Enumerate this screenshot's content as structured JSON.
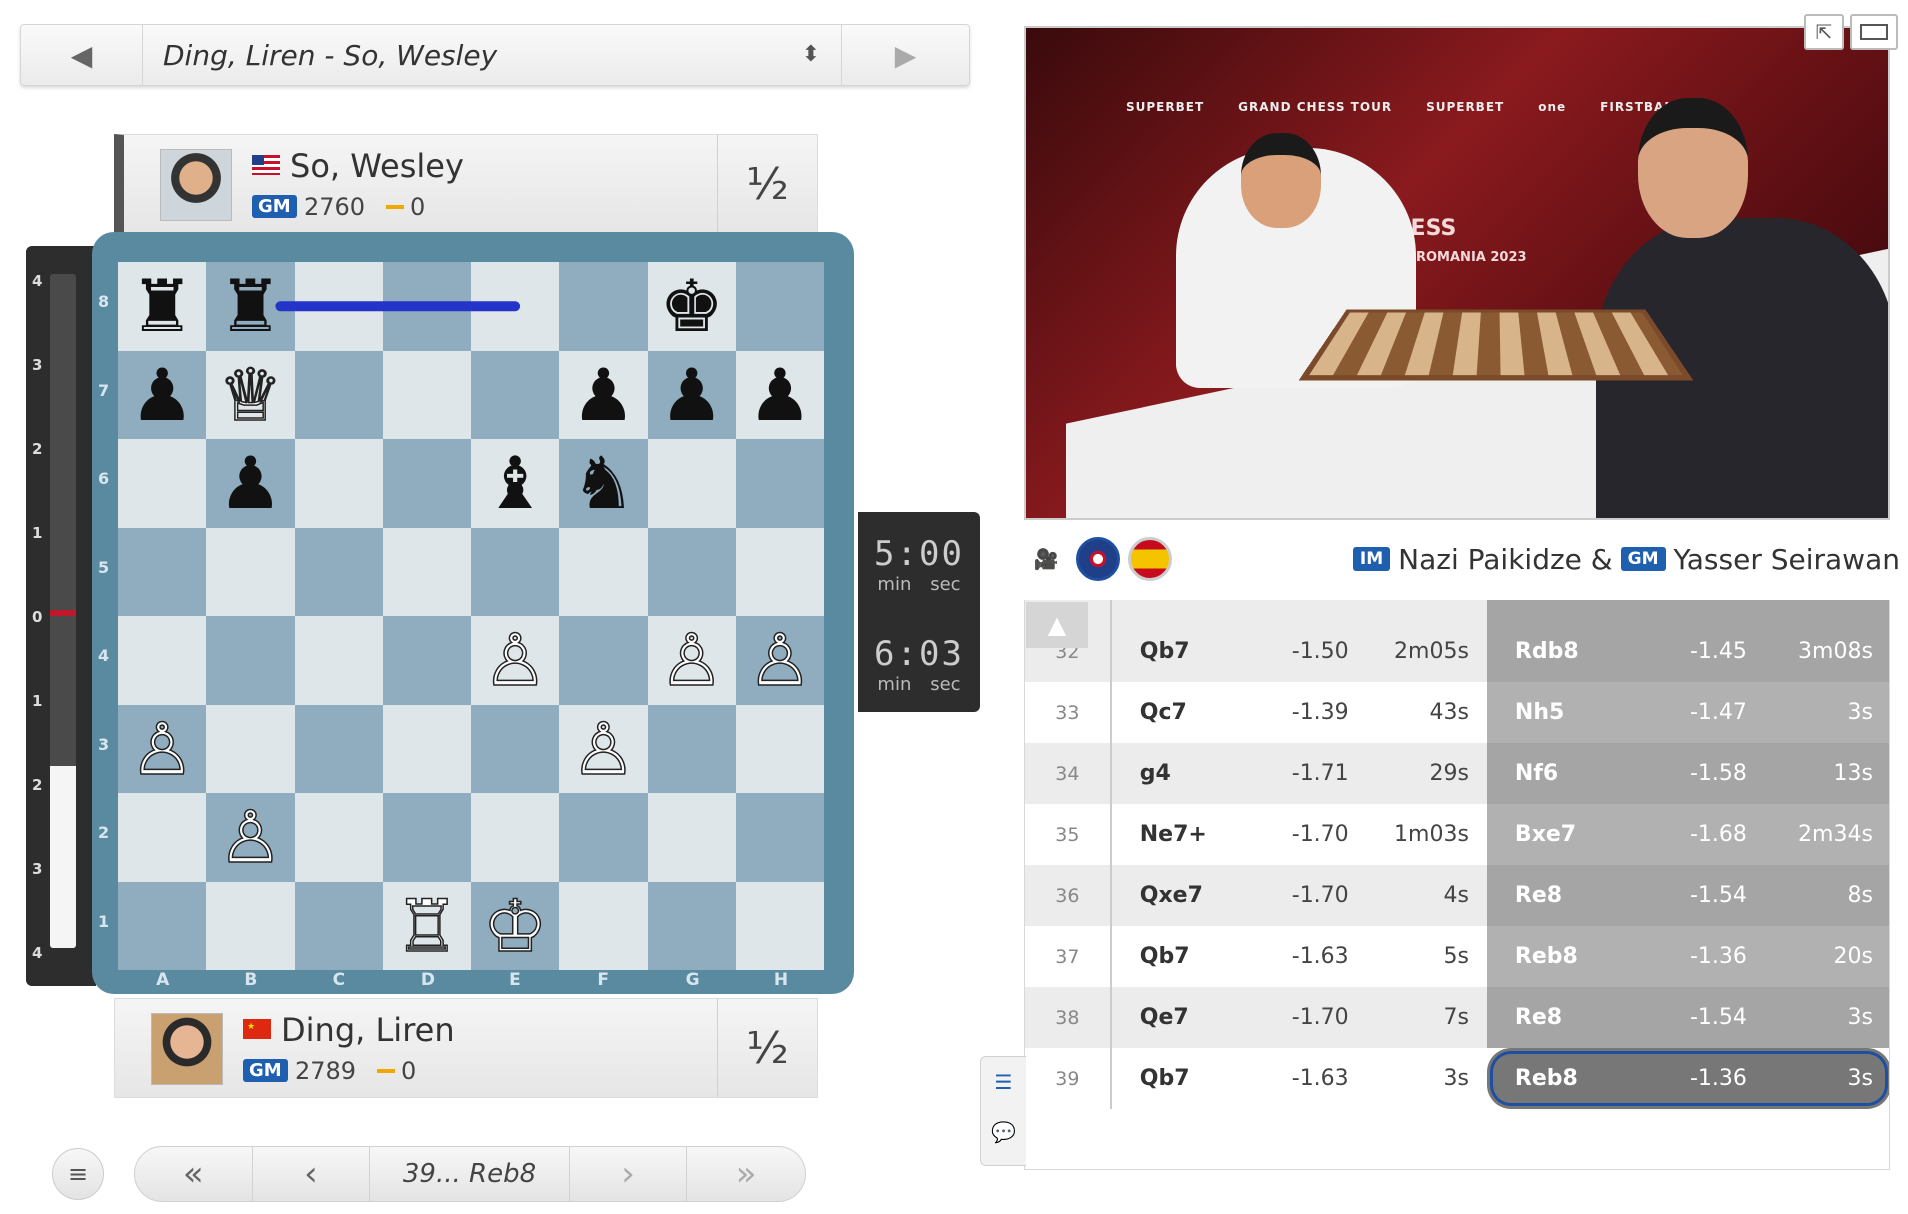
{
  "game_selector": {
    "title": "Ding, Liren - So, Wesley",
    "prev_icon": "◀",
    "next_icon": "▶",
    "updown_icon": "⬍"
  },
  "top_player": {
    "name": "So, Wesley",
    "flag": "us-flag",
    "title": "GM",
    "rating": "2760",
    "score": "0",
    "result": "½"
  },
  "bottom_player": {
    "name": "Ding, Liren",
    "flag": "cn-flag",
    "title": "GM",
    "rating": "2789",
    "score": "0",
    "result": "½"
  },
  "eval_bar": {
    "ticks": [
      "4",
      "3",
      "2",
      "1",
      "0",
      "1",
      "2",
      "3",
      "4"
    ],
    "white_share": 0.27
  },
  "board": {
    "ranks": [
      "8",
      "7",
      "6",
      "5",
      "4",
      "3",
      "2",
      "1"
    ],
    "files": [
      "A",
      "B",
      "C",
      "D",
      "E",
      "F",
      "G",
      "H"
    ],
    "position": [
      [
        "♜",
        "♜",
        "",
        "",
        "",
        "",
        "♚",
        ""
      ],
      [
        "♟",
        "♕",
        "",
        "",
        "",
        "♟",
        "♟",
        "♟"
      ],
      [
        "",
        "♟",
        "",
        "",
        "♝",
        "♞",
        "",
        ""
      ],
      [
        "",
        "",
        "",
        "",
        "",
        "",
        "",
        ""
      ],
      [
        "",
        "",
        "",
        "",
        "♙",
        "",
        "♙",
        "♙"
      ],
      [
        "♙",
        "",
        "",
        "",
        "",
        "♙",
        "",
        ""
      ],
      [
        "",
        "♙",
        "",
        "",
        "",
        "",
        "",
        ""
      ],
      [
        "",
        "",
        "",
        "♖",
        "♔",
        "",
        "",
        ""
      ]
    ],
    "last_move": {
      "from": "e8",
      "to": "b8"
    },
    "arrow_color": "#2433c8"
  },
  "clocks": {
    "top": {
      "time": "5:00",
      "min_label": "min",
      "sec_label": "sec"
    },
    "bottom": {
      "time": "6:03",
      "min_label": "min",
      "sec_label": "sec"
    }
  },
  "move_nav": {
    "first_icon": "«",
    "prev_icon": "‹",
    "current_move": "39... Reb8",
    "next_icon": "›",
    "last_icon": "»",
    "menu_icon": "≡"
  },
  "video": {
    "sponsors": [
      "SUPERBET",
      "GRAND CHESS TOUR",
      "SUPERBET",
      "one",
      "FIRSTBANK"
    ],
    "event_title": "CHESS",
    "event_subtitle": "ROMANIA 2023"
  },
  "commentary": {
    "commentator1_title": "IM",
    "commentator1_name": "Nazi Paikidze &",
    "commentator2_title": "GM",
    "commentator2_name": "Yasser Seirawan"
  },
  "moves": [
    {
      "num": "32",
      "white": "Qb7",
      "white_eval": "-1.50",
      "white_time": "2m05s",
      "black": "Rdb8",
      "black_eval": "-1.45",
      "black_time": "3m08s"
    },
    {
      "num": "33",
      "white": "Qc7",
      "white_eval": "-1.39",
      "white_time": "43s",
      "black": "Nh5",
      "black_eval": "-1.47",
      "black_time": "3s"
    },
    {
      "num": "34",
      "white": "g4",
      "white_eval": "-1.71",
      "white_time": "29s",
      "black": "Nf6",
      "black_eval": "-1.58",
      "black_time": "13s"
    },
    {
      "num": "35",
      "white": "Ne7+",
      "white_eval": "-1.70",
      "white_time": "1m03s",
      "black": "Bxe7",
      "black_eval": "-1.68",
      "black_time": "2m34s"
    },
    {
      "num": "36",
      "white": "Qxe7",
      "white_eval": "-1.70",
      "white_time": "4s",
      "black": "Re8",
      "black_eval": "-1.54",
      "black_time": "8s"
    },
    {
      "num": "37",
      "white": "Qb7",
      "white_eval": "-1.63",
      "white_time": "5s",
      "black": "Reb8",
      "black_eval": "-1.36",
      "black_time": "20s"
    },
    {
      "num": "38",
      "white": "Qe7",
      "white_eval": "-1.70",
      "white_time": "7s",
      "black": "Re8",
      "black_eval": "-1.54",
      "black_time": "3s"
    },
    {
      "num": "39",
      "white": "Qb7",
      "white_eval": "-1.63",
      "white_time": "3s",
      "black": "Reb8",
      "black_eval": "-1.36",
      "black_time": "3s"
    }
  ]
}
